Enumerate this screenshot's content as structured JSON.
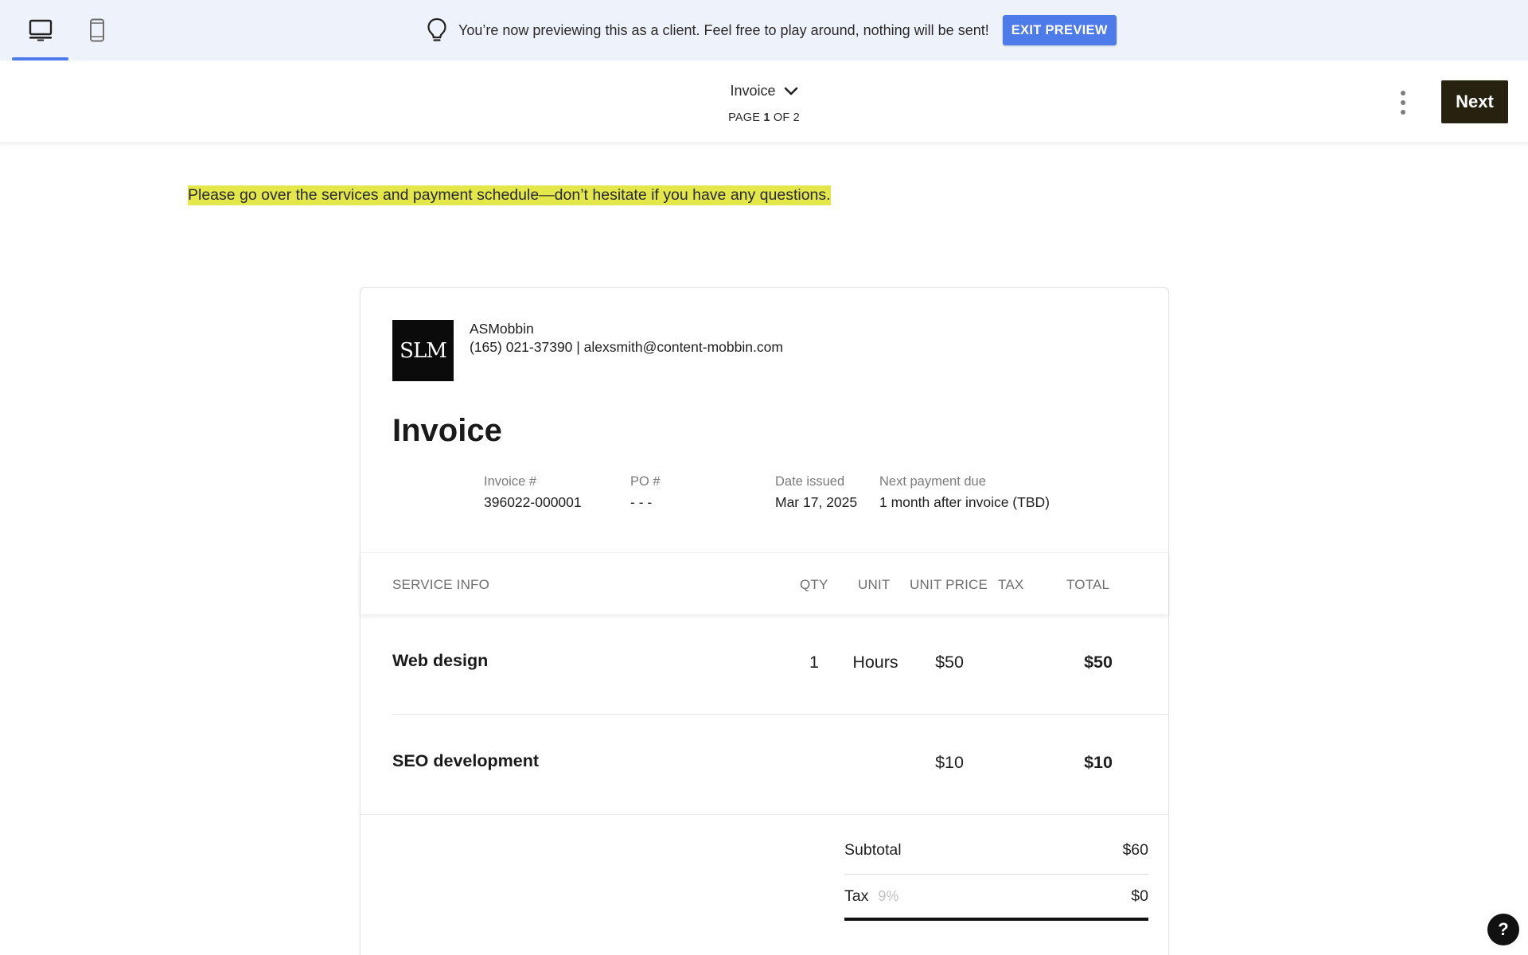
{
  "banner": {
    "message": "You’re now previewing this as a client. Feel free to play around, nothing will be sent!",
    "exit_label": "EXIT PREVIEW",
    "device_tabs": [
      {
        "icon": "desktop-icon",
        "active": true
      },
      {
        "icon": "mobile-icon",
        "active": false
      }
    ],
    "accent_color": "#4e7bea"
  },
  "toolbar": {
    "document_title": "Invoice",
    "page_prefix": "PAGE",
    "page_current": "1",
    "page_middle": "OF",
    "page_total": "2",
    "next_label": "Next"
  },
  "note": "Please go over the services and payment schedule—don’t hesitate if you have any questions.",
  "invoice": {
    "logo_text": "SLM",
    "company_name": "ASMobbin",
    "company_contact": "(165) 021-37390 | alexsmith@content-mobbin.com",
    "title": "Invoice",
    "meta": {
      "invoice_no_label": "Invoice #",
      "invoice_no": "396022-000001",
      "po_label": "PO #",
      "po_value": "- - -",
      "date_label": "Date issued",
      "date_value": "Mar 17, 2025",
      "next_due_label": "Next payment due",
      "next_due_value": "1 month after invoice (TBD)"
    },
    "columns": {
      "service": "SERVICE INFO",
      "qty": "QTY",
      "unit": "UNIT",
      "unit_price": "UNIT PRICE",
      "tax": "TAX",
      "total": "TOTAL"
    },
    "rows": [
      {
        "service": "Web design",
        "qty": "1",
        "unit": "Hours",
        "unit_price": "$50",
        "tax": "",
        "total": "$50"
      },
      {
        "service": "SEO development",
        "qty": "",
        "unit": "",
        "unit_price": "$10",
        "tax": "",
        "total": "$10"
      }
    ],
    "summary": {
      "subtotal_label": "Subtotal",
      "subtotal_value": "$60",
      "tax_label": "Tax",
      "tax_rate": "9%",
      "tax_value": "$0"
    }
  },
  "help_label": "?"
}
